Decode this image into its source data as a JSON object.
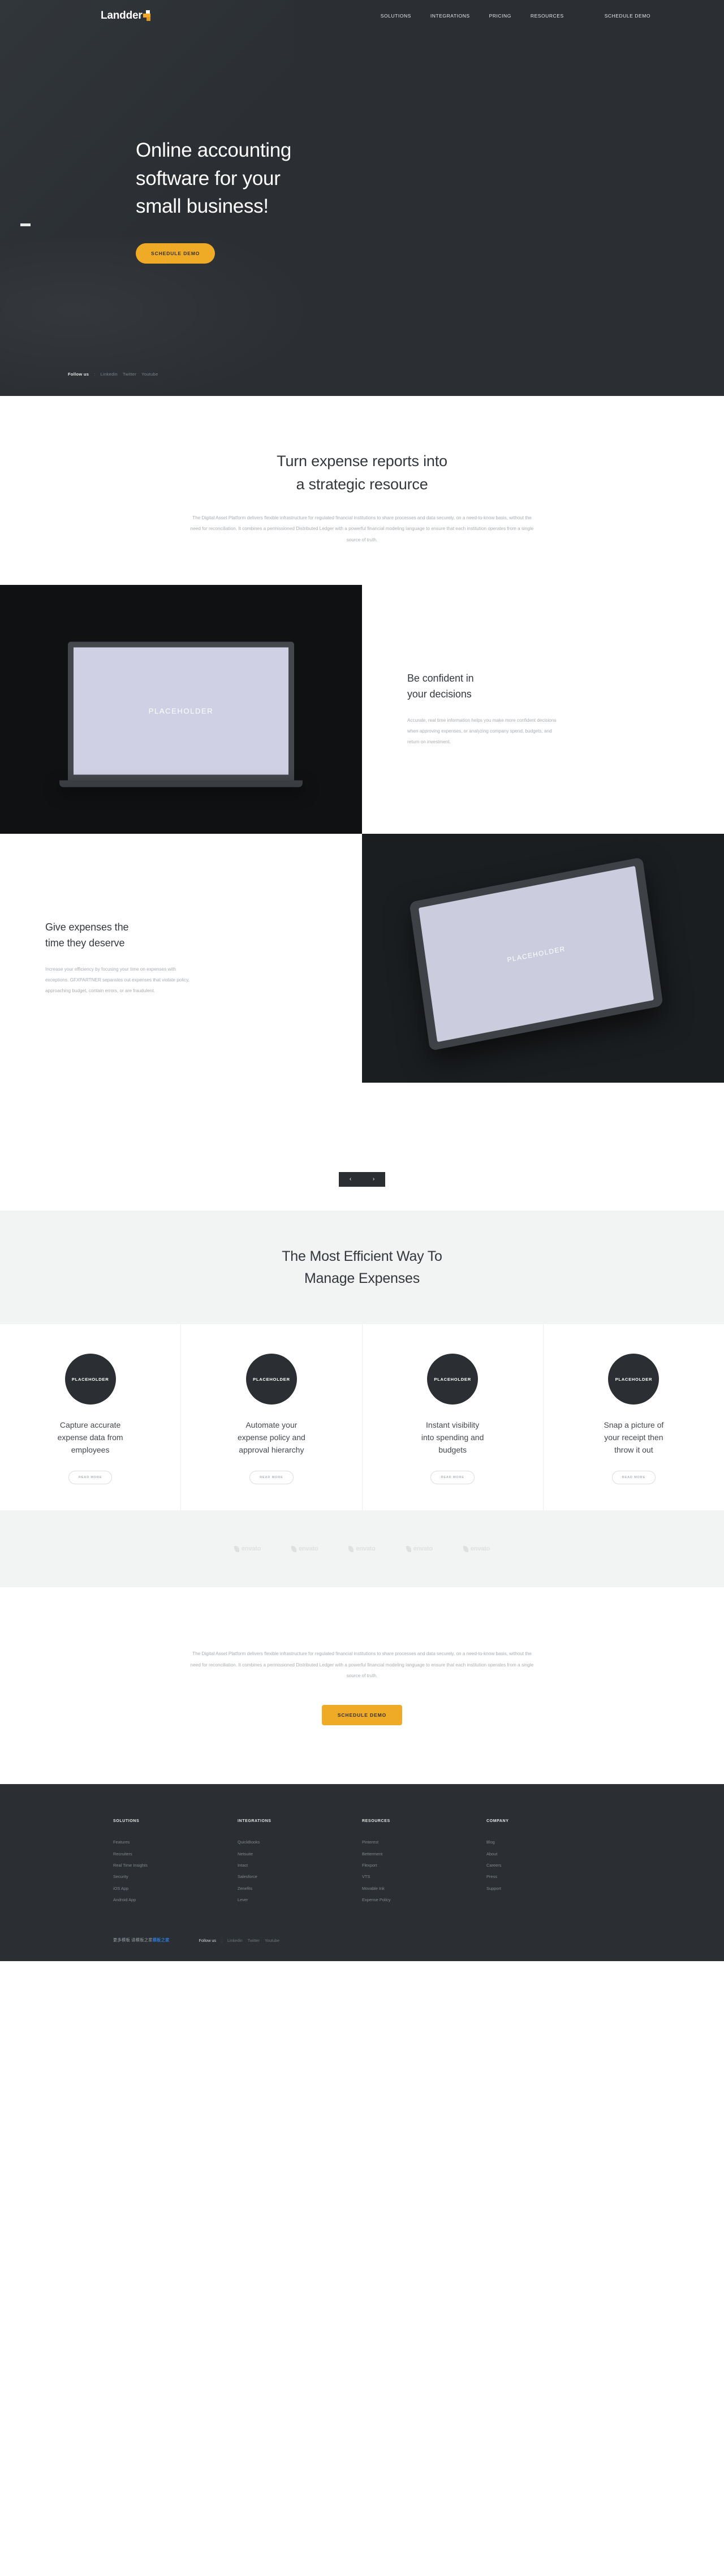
{
  "brand": {
    "name": "Landder",
    "logo_icon": "plus-blocks-icon"
  },
  "nav": {
    "items": [
      {
        "label": "SOLUTIONS"
      },
      {
        "label": "INTEGRATIONS"
      },
      {
        "label": "PRICING"
      },
      {
        "label": "RESOURCES"
      },
      {
        "label": "SCHEDULE DEMO"
      }
    ]
  },
  "hero": {
    "title": "Online accounting\nsoftware for your\nsmall business!",
    "cta_label": "SCHEDULE DEMO",
    "follow": {
      "label": "Follow us",
      "separator": ":",
      "links": [
        "Linkedin",
        "Twitter",
        "Youtube"
      ]
    }
  },
  "intro": {
    "heading": "Turn expense reports into\na strategic resource",
    "body": "The Digital Asset Platform delivers flexible infrastructure for regulated financial institutions to share processes and data securely, on a need-to-know basis, without the need for reconciliation. It combines a permissioned Distributed Ledger with a powerful financial modeling language to ensure that each institution operates from a single source of truth."
  },
  "panels": [
    {
      "media_label": "PLACEHOLDER",
      "media_type": "laptop",
      "heading": "Be confident in\nyour decisions",
      "body": "Accurate, real time information helps you make more confident decisions when approving expenses, or analyzing company spend, budgets, and return on investment."
    },
    {
      "media_label": "PLACEHOLDER",
      "media_type": "tablet",
      "heading": "Give expenses the\ntime they deserve",
      "body": "Increase your efficiency by focusing your time on expenses with exceptions. GFXPARTNER separates out expenses that violate policy, approaching budget, contain errors, or are fraudulent."
    }
  ],
  "carousel": {
    "prev_icon": "chevron-left-icon",
    "next_icon": "chevron-right-icon",
    "prev": "‹",
    "next": "›"
  },
  "features": {
    "heading": "The Most Efficient Way To\nManage Expenses",
    "cards": [
      {
        "badge": "PLACEHOLDER",
        "title": "Capture accurate\nexpense data from\nemployees",
        "button": "READ MORE"
      },
      {
        "badge": "PLACEHOLDER",
        "title": "Automate your\nexpense policy and\napproval hierarchy",
        "button": "READ MORE"
      },
      {
        "badge": "PLACEHOLDER",
        "title": "Instant visibility\ninto spending and\nbudgets",
        "button": "READ MORE"
      },
      {
        "badge": "PLACEHOLDER",
        "title": "Snap a picture of\nyour receipt then\nthrow it out",
        "button": "READ MORE"
      }
    ]
  },
  "logos": [
    {
      "name": "envato"
    },
    {
      "name": "envato"
    },
    {
      "name": "envato"
    },
    {
      "name": "envato"
    },
    {
      "name": "envato"
    }
  ],
  "cta": {
    "body": "The Digital Asset Platform delivers flexible infrastructure for regulated financial institutions to share processes and data securely, on a need-to-know basis, without the need for reconciliation. It combines a permissioned Distributed Ledger with a powerful financial modeling language to ensure that each institution operates from a single source of truth.",
    "button": "SCHEDULE DEMO"
  },
  "footer": {
    "columns": [
      {
        "title": "SOLUTIONS",
        "links": [
          "Features",
          "Recruiters",
          "Real Time Insights",
          "Security",
          "iOS App",
          "Android App"
        ]
      },
      {
        "title": "INTEGRATIONS",
        "links": [
          "QuickBooks",
          "Netsuite",
          "Intact",
          "Salesforce",
          "Zenefits",
          "Lever"
        ]
      },
      {
        "title": "RESOURCES",
        "links": [
          "Pinterest",
          "Betterment",
          "Flexport",
          "VTS",
          "Movable Ink",
          "Expense Policy"
        ]
      },
      {
        "title": "COMPANY",
        "links": [
          "Blog",
          "About",
          "Careers",
          "Press",
          "Support"
        ]
      }
    ],
    "bottom": {
      "credit_prefix": "更多模板 请模板之家",
      "credit_link": "模板之家",
      "follow_label": "Follow us",
      "follow_separator": ":",
      "follow_links": [
        "Linkedin",
        "Twitter",
        "Youtube"
      ]
    }
  },
  "colors": {
    "dark": "#2b2f33",
    "accent": "#efab26",
    "muted": "#a9adb1",
    "panel_light": "#f2f3f3",
    "link_blue": "#2a79d6"
  }
}
